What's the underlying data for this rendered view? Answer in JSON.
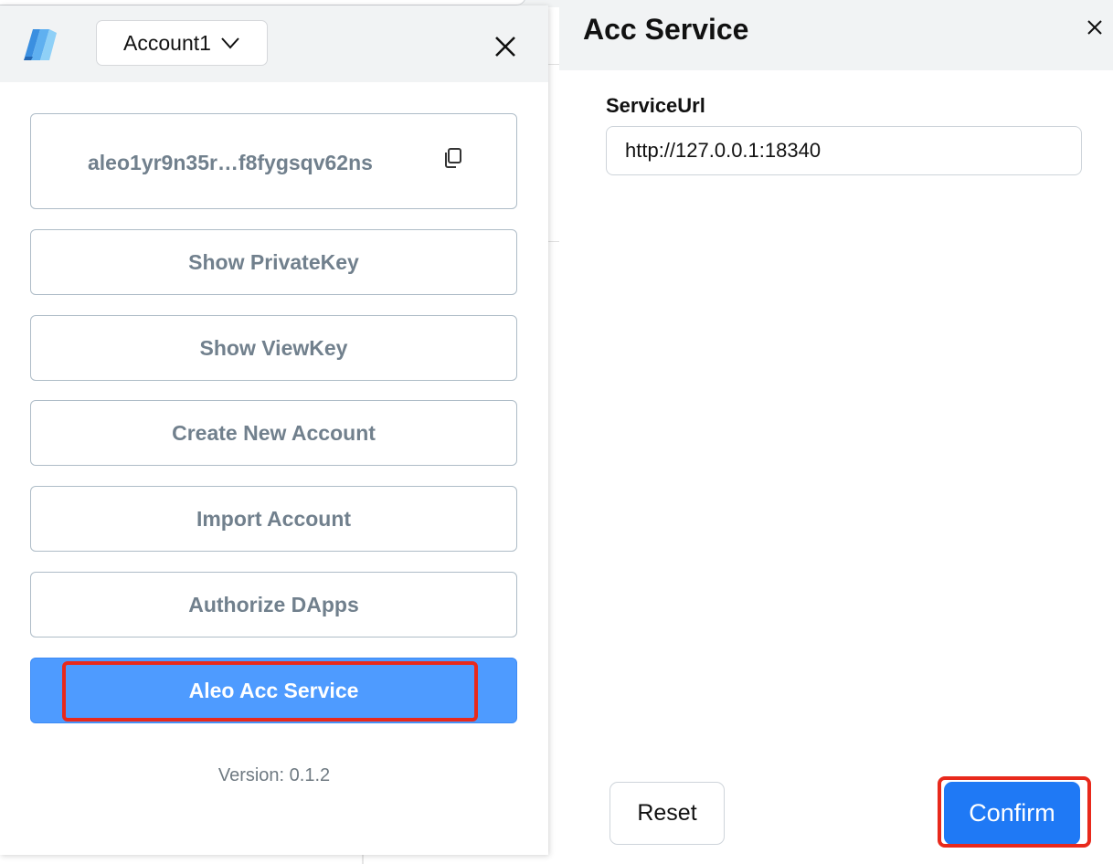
{
  "popup": {
    "account_select": {
      "label": "Account1",
      "chevron_icon": "chevron-down-icon"
    },
    "logo_icon": "soter-logo-icon",
    "close_icon": "close-icon",
    "address": {
      "text": "aleo1yr9n35r…f8fygsqv62ns",
      "copy_icon": "copy-icon"
    },
    "menu": [
      {
        "label": "Show PrivateKey"
      },
      {
        "label": "Show ViewKey"
      },
      {
        "label": "Create New Account"
      },
      {
        "label": "Import Account"
      },
      {
        "label": "Authorize DApps"
      }
    ],
    "active_item": {
      "label": "Aleo Acc Service"
    },
    "version": "Version: 0.1.2"
  },
  "panel": {
    "title": "Acc Service",
    "close_icon": "close-icon",
    "service_url": {
      "label": "ServiceUrl",
      "value": "http://127.0.0.1:18340"
    },
    "reset_label": "Reset",
    "confirm_label": "Confirm"
  },
  "colors": {
    "header_bg": "#f1f3f4",
    "button_text": "#71808d",
    "button_border": "#aebcc7",
    "active_button_bg": "#4e9bff",
    "confirm_bg": "#1f79f5",
    "highlight": "#e8291c"
  }
}
